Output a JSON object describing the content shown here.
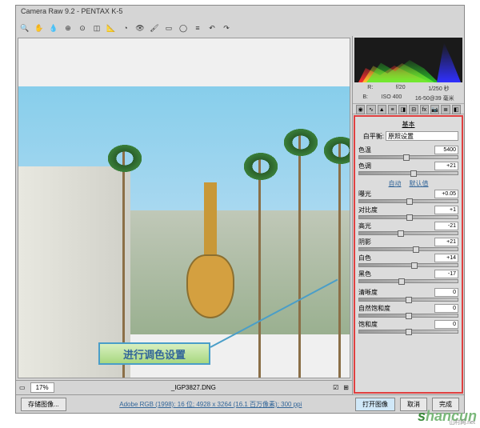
{
  "title": "Camera Raw 9.2  -  PENTAX K-5",
  "zoom": {
    "value": "17%",
    "filename": "_IGP3827.DNG"
  },
  "exif": {
    "aperture": "f/20",
    "shutter": "1/250 秒",
    "iso": "ISO 400",
    "lens": "16-50@39 毫米"
  },
  "panel_title": "基本",
  "wb": {
    "label": "白平衡:",
    "value": "原照设置"
  },
  "sliders": {
    "temp": {
      "label": "色温",
      "value": "5400",
      "pos": 48
    },
    "tint": {
      "label": "色调",
      "value": "+21",
      "pos": 55
    },
    "exposure": {
      "label": "曝光",
      "value": "+0.05",
      "pos": 51
    },
    "contrast": {
      "label": "对比度",
      "value": "+1",
      "pos": 51
    },
    "highlights": {
      "label": "高光",
      "value": "-21",
      "pos": 42
    },
    "shadows": {
      "label": "阴影",
      "value": "+21",
      "pos": 58
    },
    "whites": {
      "label": "白色",
      "value": "+14",
      "pos": 56
    },
    "blacks": {
      "label": "黑色",
      "value": "-17",
      "pos": 43
    },
    "clarity": {
      "label": "清晰度",
      "value": "0",
      "pos": 50
    },
    "vibrance": {
      "label": "自然饱和度",
      "value": "0",
      "pos": 50
    },
    "saturation": {
      "label": "饱和度",
      "value": "0",
      "pos": 50
    }
  },
  "auto": {
    "auto": "自动",
    "default": "默认值"
  },
  "annotation": "进行调色设置",
  "bottom": {
    "save": "存储图像...",
    "link": "Adobe RGB (1998): 16 位;  4928 x 3264 (16.1 百万像素); 300 ppi",
    "open": "打开图像",
    "cancel": "取消",
    "done": "完成"
  },
  "watermark": {
    "main": "shancun",
    "sub": "山村网.net"
  }
}
